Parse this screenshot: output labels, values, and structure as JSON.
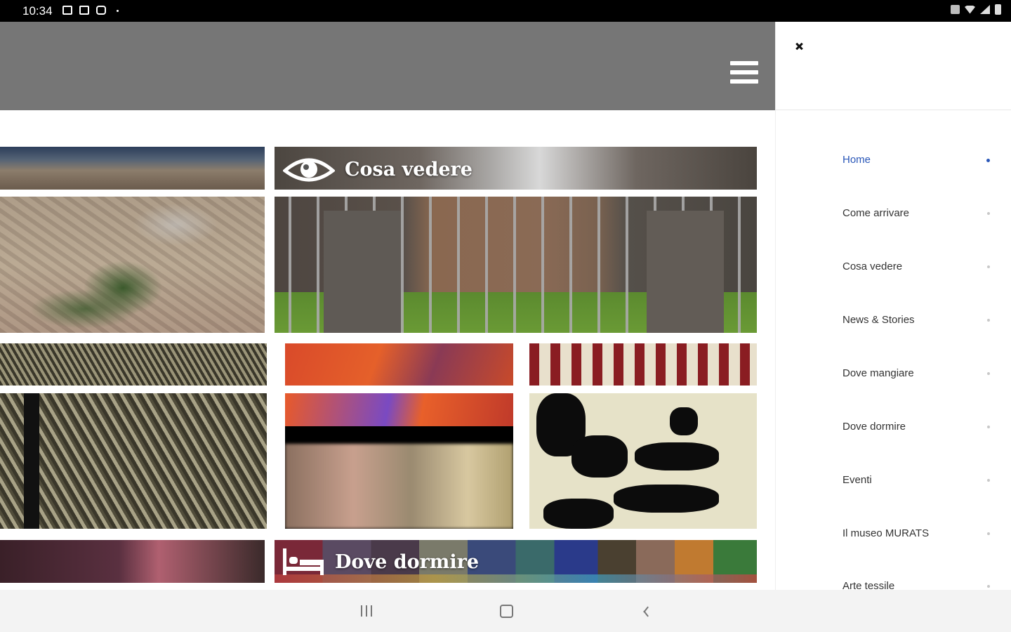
{
  "status_bar": {
    "time": "10:34",
    "left_icons": [
      "image-icon",
      "gallery-icon",
      "chat-icon"
    ],
    "right_icons": [
      "mute-icon",
      "wifi-icon",
      "signal-icon",
      "battery-icon"
    ]
  },
  "header": {
    "background_color": "#767676",
    "menu_icon": "hamburger-menu-icon"
  },
  "tiles": [
    {
      "id": "aerial-view",
      "label": ""
    },
    {
      "id": "cosa-vedere",
      "label": "Cosa vedere",
      "icon": "eye-icon"
    },
    {
      "id": "textile-art-1",
      "label": ""
    },
    {
      "id": "textile-art-2",
      "label": ""
    },
    {
      "id": "textile-art-3",
      "label": ""
    },
    {
      "id": "food",
      "label": ""
    },
    {
      "id": "dove-dormire",
      "label": "Dove dormire",
      "icon": "bed-icon"
    }
  ],
  "drawer": {
    "close_icon": "close-icon",
    "accent_color": "#2a57b8",
    "items": [
      {
        "label": "Home",
        "active": true
      },
      {
        "label": "Come arrivare",
        "active": false
      },
      {
        "label": "Cosa vedere",
        "active": false
      },
      {
        "label": "News & Stories",
        "active": false
      },
      {
        "label": "Dove mangiare",
        "active": false
      },
      {
        "label": "Dove dormire",
        "active": false
      },
      {
        "label": "Eventi",
        "active": false
      },
      {
        "label": "Il museo MURATS",
        "active": false
      },
      {
        "label": "Arte tessile",
        "active": false
      }
    ]
  },
  "nav_bar": {
    "buttons": [
      "recent-apps-icon",
      "home-icon",
      "back-icon"
    ]
  }
}
